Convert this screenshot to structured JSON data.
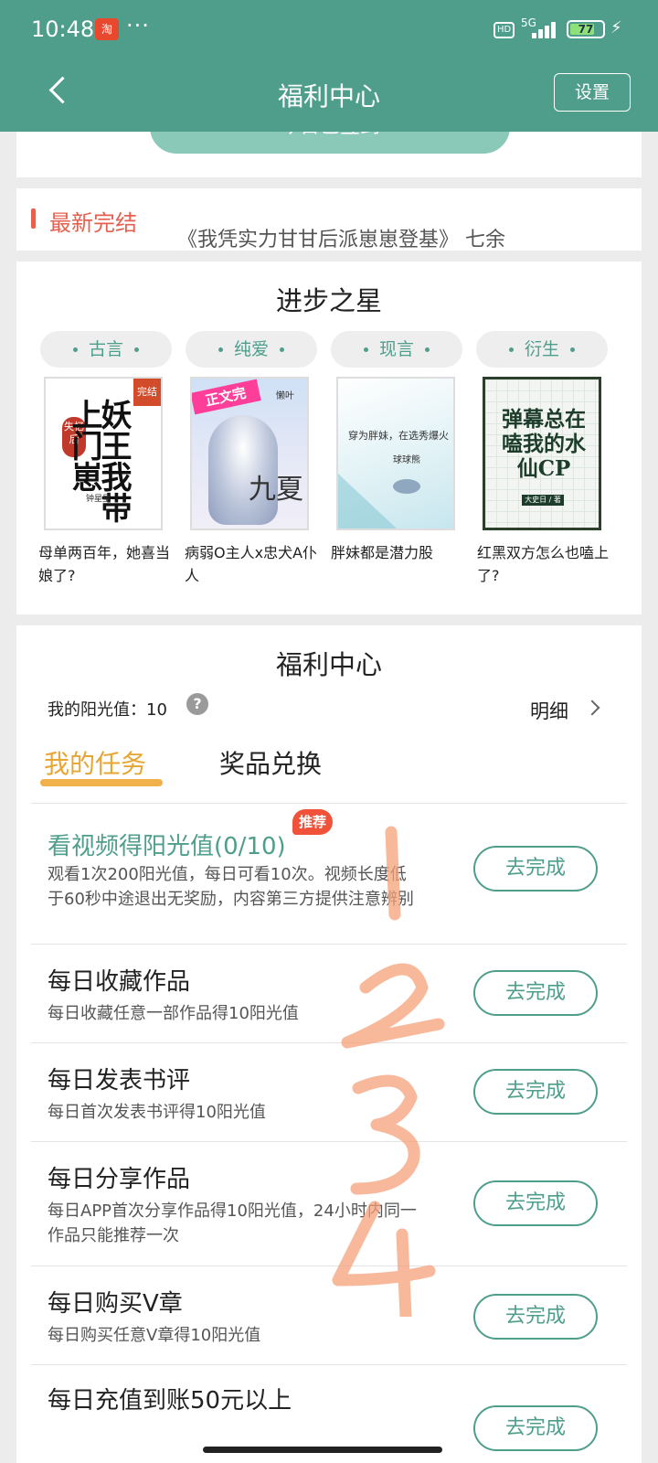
{
  "status_bar": {
    "time": "10:48",
    "more": "···",
    "hd": "HD",
    "network": "5G",
    "battery_level": "77",
    "battery_fraction": 0.77,
    "app_badge": "淘"
  },
  "header": {
    "title": "福利中心",
    "settings_label": "设置"
  },
  "sign_card": {
    "button_label": "今日已签到"
  },
  "latest": {
    "label": "最新完结",
    "scroll_text": "《我凭实力甘甘后派崽崽登基》    七余"
  },
  "progress_stars": {
    "title": "进步之星",
    "tags": [
      "古言",
      "纯爱",
      "现言",
      "衍生"
    ],
    "books": [
      {
        "title": "母单两百年，她喜当娘了?",
        "cover_title": "妖王我带上门崽",
        "cover_badge": "完结",
        "cover_tag": "失忆后",
        "cover_author": "钟星星"
      },
      {
        "title": "病弱O主人x忠犬A仆人",
        "cover_banner": "正文完",
        "cover_sig": "九夏",
        "cover_side": "懒叶"
      },
      {
        "title": "胖妹都是潜力股",
        "cover_title": "穿为胖妹，在选秀爆火",
        "cover_author": "球球熊"
      },
      {
        "title": "红黑双方怎么也嗑上了?",
        "cover_title": "弹幕总在嗑我的水仙CP",
        "cover_author": "大史日 / 著"
      }
    ]
  },
  "welfare": {
    "title": "福利中心",
    "sunshine_label": "我的阳光值：10",
    "help": "?",
    "detail_label": "明细",
    "tabs": {
      "my_tasks": "我的任务",
      "prizes": "奖品兑换"
    },
    "recommend_badge": "推荐",
    "tasks": [
      {
        "name": "看视频得阳光值(0/10)",
        "desc": "观看1次200阳光值，每日可看10次。视频长度低于60秒中途退出无奖励，内容第三方提供注意辨别",
        "button": "去完成"
      },
      {
        "name": "每日收藏作品",
        "desc": "每日收藏任意一部作品得10阳光值",
        "button": "去完成"
      },
      {
        "name": "每日发表书评",
        "desc": "每日首次发表书评得10阳光值",
        "button": "去完成"
      },
      {
        "name": "每日分享作品",
        "desc": "每日APP首次分享作品得10阳光值，24小时内同一作品只能推荐一次",
        "button": "去完成"
      },
      {
        "name": "每日购买V章",
        "desc": "每日购买任意V章得10阳光值",
        "button": "去完成"
      },
      {
        "name": "每日充值到账50元以上",
        "desc": "",
        "button": "去完成"
      }
    ]
  },
  "colors": {
    "brand": "#4f9e8c",
    "accent_orange": "#f0b14a",
    "red": "#e46050",
    "scribble": "#f5a17a"
  },
  "icons": [
    "back-icon",
    "help-icon",
    "chevron-right-icon",
    "signal-icon",
    "battery-icon",
    "charging-icon"
  ]
}
